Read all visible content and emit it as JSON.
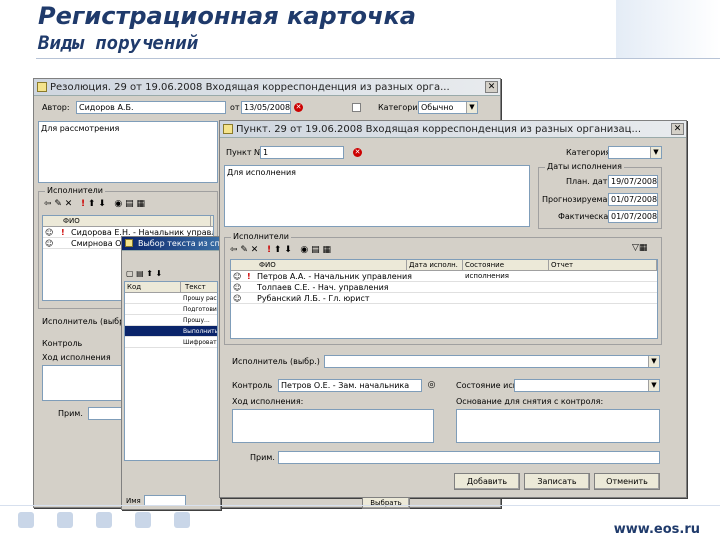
{
  "slide": {
    "title": "Регистрационная карточка",
    "subtitle": "Виды поручений",
    "footer_url": "www.eos.ru"
  },
  "win1": {
    "title": "Резолюция. 29 от 19.06.2008 Входящая корреспонденция из разных орга...",
    "author_label": "Автор:",
    "author_value": "Сидоров А.Б.",
    "date_label": "от",
    "date_value": "13/05/2008",
    "category_label": "Категория:",
    "category_value": "Обычно",
    "category_label2": "Категория:",
    "text_value": "Для рассмотрения",
    "executors_group": "Исполнители",
    "grid_header": "ФИО",
    "rows": [
      "Сидорова Е.Н. - Начальник управления",
      "Смирнова О."
    ],
    "executor_label": "Исполнитель (выбр.)",
    "control_label": "Контроль",
    "execution_label": "Ход исполнения",
    "note_label": "Прим."
  },
  "win2": {
    "title": "Выбор текста из списка",
    "col_code": "Код",
    "col_text": "Текст",
    "rows": [
      "Прошу рассм...",
      "Подготовить...",
      "Прошу...",
      "Выполнить...",
      "Шифровать..."
    ],
    "name_label": "Имя",
    "select_btn": "Выбрать"
  },
  "win3": {
    "title": "Пункт. 29 от 19.06.2008 Входящая корреспонденция из разных организац...",
    "point_label": "Пункт №:",
    "point_value": "1",
    "category_label": "Категория:",
    "text_value": "Для исполнения",
    "dates_group": "Даты исполнения",
    "plan_label": "План. дата:",
    "plan_value": "19/07/2008",
    "forecast_label": "Прогнозируемая:",
    "forecast_value": "01/07/2008",
    "fact_label": "Фактическая:",
    "fact_value": "01/07/2008",
    "executors_group": "Исполнители",
    "col_fio": "ФИО",
    "col_date": "Дата исполн.",
    "col_status": "Состояние исполнения",
    "col_report": "Отчет",
    "rows": [
      "Петров А.А. - Начальник управления",
      "Толпаев С.Е. - Нач. управления",
      "Рубанский Л.Б. - Гл. юрист"
    ],
    "executor_label": "Исполнитель (выбр.)",
    "control_label": "Контроль",
    "control_value": "Петров О.Е. - Зам. начальника",
    "state_label": "Состояние исп.",
    "execution_label": "Ход исполнения:",
    "reason_label": "Основание для снятия с контроля:",
    "note_label": "Прим.",
    "add_btn": "Добавить",
    "save_btn": "Записать",
    "cancel_btn": "Отменить"
  }
}
